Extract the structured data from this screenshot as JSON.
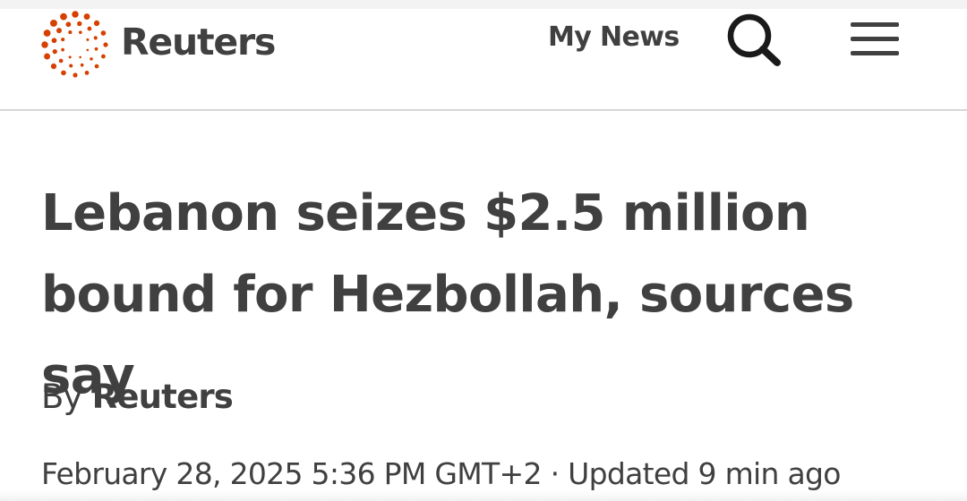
{
  "header": {
    "logo_text": "Reuters",
    "my_news_label": "My News",
    "search_icon": "search-icon",
    "menu_icon": "hamburger-menu-icon"
  },
  "article": {
    "headline_line1": "Lebanon seizes $2.5 million",
    "headline_line2": "bound for Hezbollah, sources say",
    "byline_prefix": "By",
    "byline_author": "Reuters",
    "published": "February 28, 2025 5:36 PM GMT+2",
    "separator": "·",
    "updated": "Updated 9 min ago"
  },
  "colors": {
    "brand_dots": "#d64000",
    "text": "#404040",
    "divider": "#d6d6d6"
  }
}
